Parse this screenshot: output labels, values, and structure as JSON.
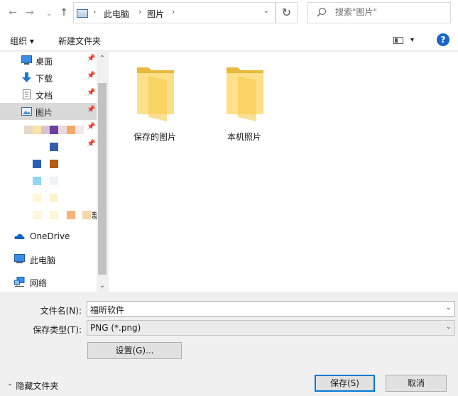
{
  "nav_buttons": {
    "back": "←",
    "forward": "→",
    "recent": "⌄",
    "up": "↑"
  },
  "address": {
    "crumbs": [
      "此电脑",
      "图片"
    ],
    "sep": "›",
    "dropdown": "⌄",
    "refresh": "↻"
  },
  "search": {
    "placeholder": "搜索\"图片\""
  },
  "toolbar": {
    "organize": "组织 ▾",
    "new_folder": "新建文件夹",
    "view_arrow": "▾",
    "help": "?"
  },
  "sidebar": {
    "quick": [
      {
        "label": "桌面",
        "icon": "desktop-icon",
        "pinned": true
      },
      {
        "label": "下载",
        "icon": "download-icon",
        "pinned": true
      },
      {
        "label": "文档",
        "icon": "document-icon",
        "pinned": true
      },
      {
        "label": "图片",
        "icon": "pictures-icon",
        "pinned": true,
        "selected": true
      }
    ],
    "partial_text": "新",
    "roots": [
      {
        "label": "OneDrive",
        "icon": "onedrive-icon"
      },
      {
        "label": "此电脑",
        "icon": "this-pc-icon"
      },
      {
        "label": "网络",
        "icon": "network-icon"
      }
    ],
    "pin_glyph": "📌",
    "scroll_up": "⌃",
    "scroll_down": "⌄"
  },
  "folders": [
    {
      "name": "保存的图片"
    },
    {
      "name": "本机照片"
    }
  ],
  "filename": {
    "label": "文件名(N):",
    "value": "福昕软件",
    "arrow": "⌄"
  },
  "filetype": {
    "label": "保存类型(T):",
    "value": "PNG (*.png)",
    "arrow": "⌄"
  },
  "settings_button": "设置(G)...",
  "hide_folders": "隐藏文件夹",
  "hide_arrow": "⌃",
  "save_button": "保存(S)",
  "cancel_button": "取消",
  "colors": {
    "accent": "#0078d7",
    "folder": "#ffd866",
    "selection": "#d9d9d9",
    "help": "#1a66c8"
  }
}
